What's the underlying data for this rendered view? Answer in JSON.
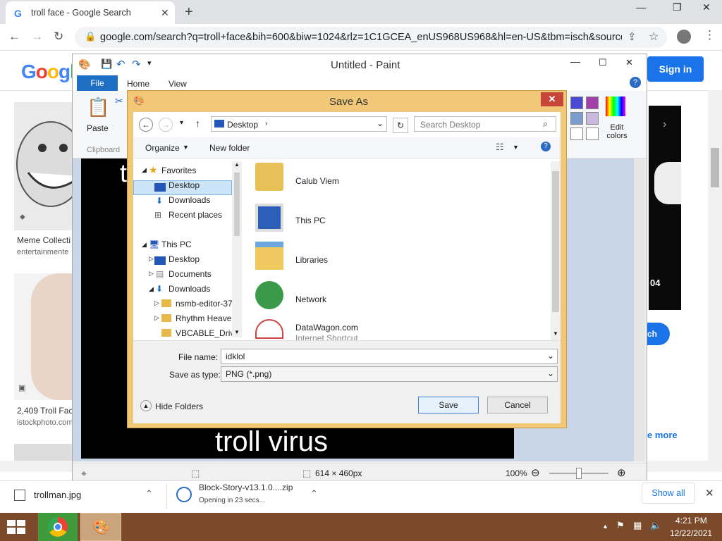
{
  "browser": {
    "tab_title": "troll face - Google Search",
    "url": "google.com/search?q=troll+face&bih=600&biw=1024&rlz=1C1GCEA_enUS968US968&hl=en-US&tbm=isch&source...",
    "sign_in": "Sign in",
    "logo": "Google"
  },
  "google_page": {
    "result1_title": "Meme Collecti",
    "result1_source": "entertainmente",
    "result2_title": "2,409 Troll Fac",
    "result2_source": "istockphoto.com",
    "right_num": "04",
    "right_btn": "ch",
    "see_more": "e more"
  },
  "paint": {
    "title": "Untitled - Paint",
    "tabs": [
      "File",
      "Home",
      "View"
    ],
    "paste": "Paste",
    "clipboard": "Clipboard",
    "edit_colors": "Edit colors",
    "canvas_text_top": "t",
    "canvas_caption": "troll virus",
    "status_size": "614 × 460px",
    "zoom": "100%",
    "palette": [
      "#4b4bd2",
      "#a040a8",
      "#7b9ccf",
      "#c9b8e0",
      "#ffffff",
      "#ffffff"
    ]
  },
  "dialog": {
    "title": "Save As",
    "path": "Desktop",
    "search_placeholder": "Search Desktop",
    "organize": "Organize",
    "new_folder": "New folder",
    "nav": [
      {
        "label": "Favorites",
        "indent": 0
      },
      {
        "label": "Desktop",
        "indent": 1
      },
      {
        "label": "Downloads",
        "indent": 1
      },
      {
        "label": "Recent places",
        "indent": 1
      },
      {
        "label": "This PC",
        "indent": 0
      },
      {
        "label": "Desktop",
        "indent": 1
      },
      {
        "label": "Documents",
        "indent": 1
      },
      {
        "label": "Downloads",
        "indent": 1
      },
      {
        "label": "nsmb-editor-37",
        "indent": 2
      },
      {
        "label": "Rhythm Heave",
        "indent": 2
      },
      {
        "label": "VBCABLE_Drive",
        "indent": 2
      }
    ],
    "files": [
      {
        "name": "Calub Viem",
        "icon": "user-folder-icon",
        "sub": ""
      },
      {
        "name": "This PC",
        "icon": "computer-icon",
        "sub": ""
      },
      {
        "name": "Libraries",
        "icon": "libraries-icon",
        "sub": ""
      },
      {
        "name": "Network",
        "icon": "network-icon",
        "sub": ""
      },
      {
        "name": "DataWagon.com",
        "icon": "internet-shortcut-icon",
        "sub": "Internet Shortcut"
      }
    ],
    "file_name_label": "File name:",
    "file_name_value": "idklol",
    "save_type_label": "Save as type:",
    "save_type_value": "PNG (*.png)",
    "hide_folders": "Hide Folders",
    "save": "Save",
    "cancel": "Cancel"
  },
  "downloads": {
    "item1": "trollman.jpg",
    "item2": "Block-Story-v13.1.0....zip",
    "item2_status": "Opening in 23 secs...",
    "show_all": "Show all"
  },
  "taskbar": {
    "time": "4:21 PM",
    "date": "12/22/2021"
  }
}
